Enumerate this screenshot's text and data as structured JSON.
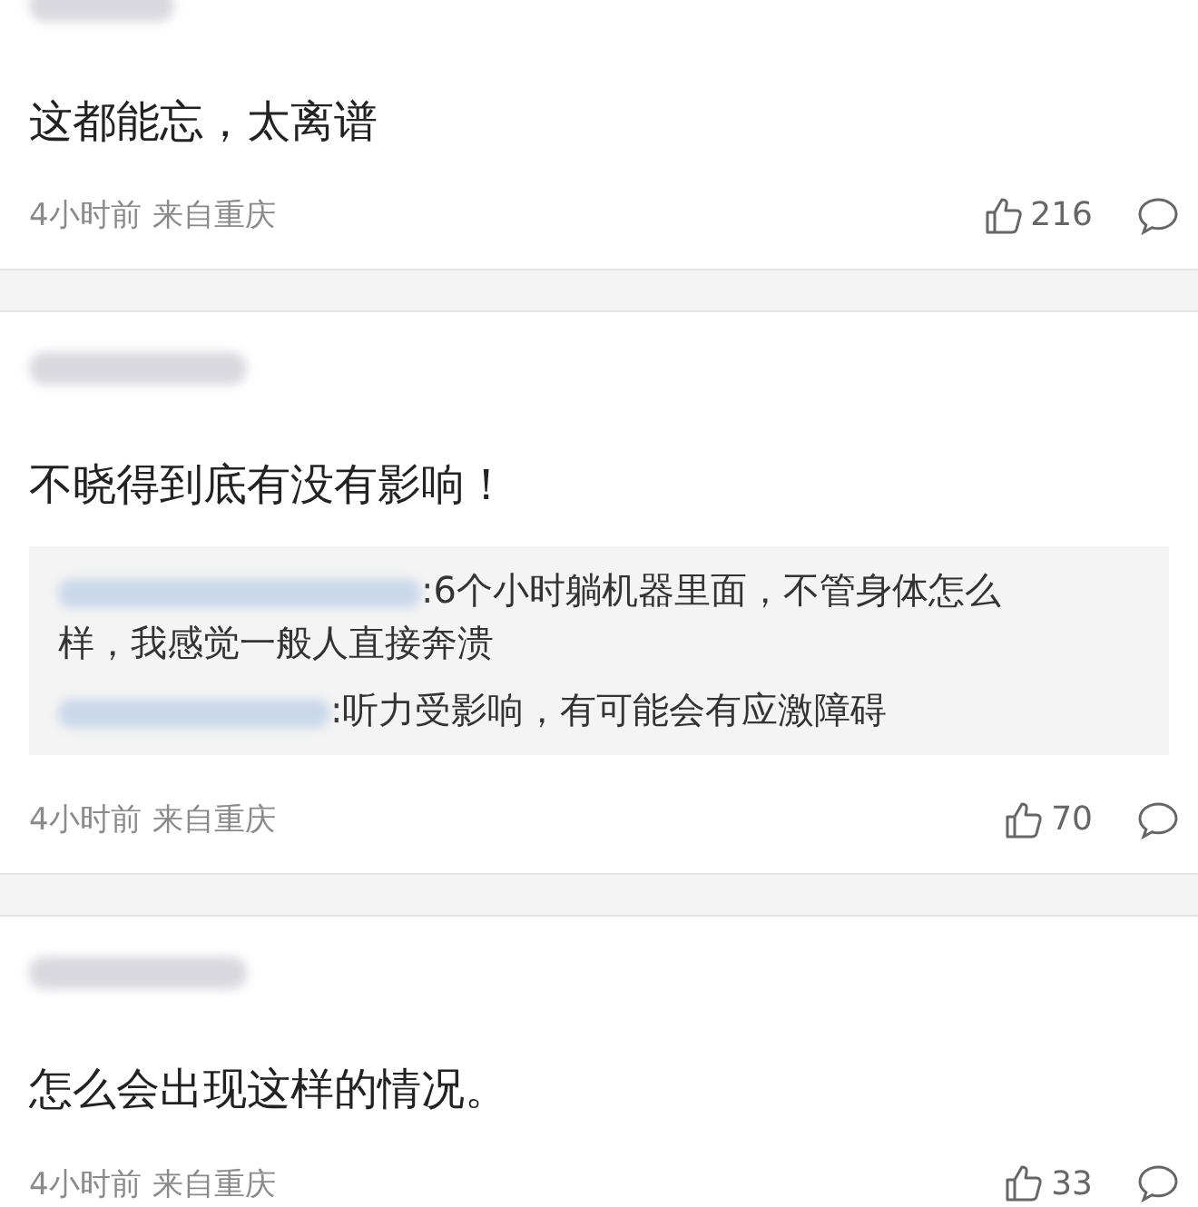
{
  "comments": [
    {
      "text": "这都能忘，太离谱",
      "time": "4小时前",
      "location": "来自重庆",
      "likes": "216",
      "name_cut": true
    },
    {
      "text": "不晓得到底有没有影响！",
      "replies": [
        {
          "text": ":6个小时躺机器里面，不管身体怎么样，我感觉一般人直接奔溃"
        },
        {
          "text": ":听力受影响，有可能会有应激障碍"
        }
      ],
      "time": "4小时前",
      "location": "来自重庆",
      "likes": "70",
      "name_cut": false
    },
    {
      "text": "怎么会出现这样的情况。",
      "time": "4小时前",
      "location": "来自重庆",
      "likes": "33",
      "name_cut": false
    }
  ]
}
